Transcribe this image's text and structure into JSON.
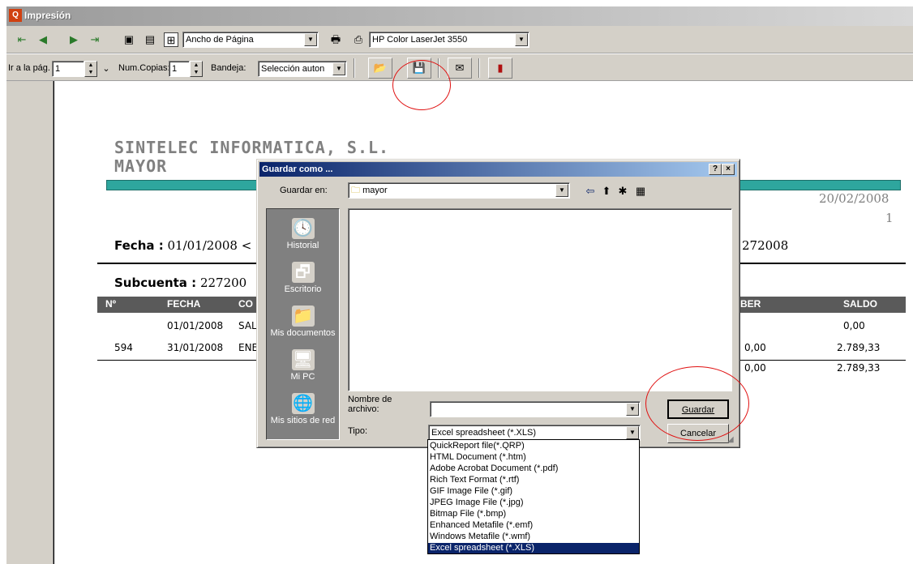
{
  "window": {
    "title": "Impresión"
  },
  "toolbar1": {
    "zoom_value": "Ancho de Página",
    "printer_value": "HP Color LaserJet 3550"
  },
  "toolbar2": {
    "page_label": "Ir a la pág.",
    "page_value": "1",
    "copies_label": "Num.Copias:",
    "copies_value": "1",
    "tray_label": "Bandeja:",
    "tray_value": "Selección auton"
  },
  "report": {
    "company": "SINTELEC INFORMATICA, S.L.",
    "title": "MAYOR",
    "date": "20/02/2008",
    "page_number": "1",
    "fecha_label": "Fecha :",
    "fecha_value": "01/01/2008 <",
    "cuenta_value": "272008",
    "subcuenta_label": "Subcuenta :",
    "subcuenta_value": "227200",
    "columns": [
      "Nº",
      "FECHA",
      "CO",
      "BER",
      "SALDO"
    ],
    "rows": [
      {
        "num": "",
        "fecha": "01/01/2008",
        "concepto": "SAL",
        "haber": "",
        "saldo": "0,00"
      },
      {
        "num": "594",
        "fecha": "31/01/2008",
        "concepto": "ENE",
        "haber": "0,00",
        "saldo": "2.789,33"
      }
    ],
    "totals": {
      "haber": "0,00",
      "saldo": "2.789,33"
    }
  },
  "dialog": {
    "title": "Guardar como ...",
    "help_label": "?",
    "close_label": "×",
    "save_in_label": "Guardar en:",
    "save_in_value": "mayor",
    "places": [
      {
        "label": "Historial",
        "icon": "history-icon"
      },
      {
        "label": "Escritorio",
        "icon": "desktop-icon"
      },
      {
        "label": "Mis documentos",
        "icon": "my-documents-icon"
      },
      {
        "label": "Mi PC",
        "icon": "my-computer-icon"
      },
      {
        "label": "Mis sitios de red",
        "icon": "network-places-icon"
      }
    ],
    "filename_label": "Nombre de archivo:",
    "filename_value": "",
    "type_label": "Tipo:",
    "type_value": "Excel spreadsheet (*.XLS)",
    "save_button": "Guardar",
    "cancel_button": "Cancelar",
    "type_options": [
      "QuickReport file(*.QRP)",
      "HTML Document (*.htm)",
      "Adobe Acrobat Document (*.pdf)",
      "Rich Text Format (*.rtf)",
      "GIF Image File (*.gif)",
      "JPEG Image File (*.jpg)",
      "Bitmap File (*.bmp)",
      "Enhanced Metafile (*.emf)",
      "Windows Metafile (*.wmf)",
      "Excel spreadsheet (*.XLS)"
    ],
    "selected_option_index": 9
  },
  "colors": {
    "accent_teal": "#2ea69e",
    "selection": "#0a246a",
    "annotation_circle": "#e01010"
  }
}
